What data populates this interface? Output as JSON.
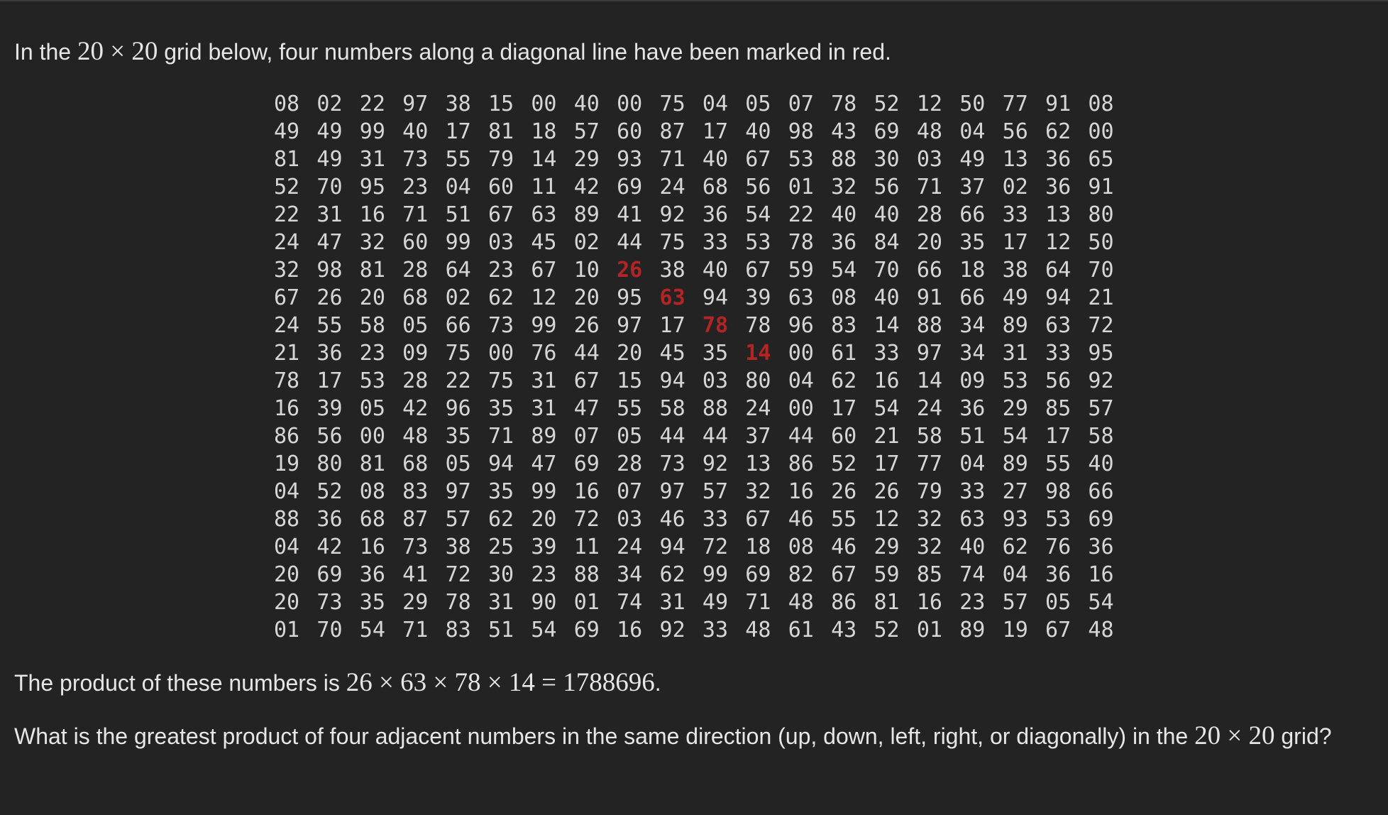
{
  "intro": {
    "before": "In the ",
    "math": "20 × 20",
    "after": " grid below, four numbers along a diagonal line have been marked in red."
  },
  "grid": {
    "rows": [
      [
        "08",
        "02",
        "22",
        "97",
        "38",
        "15",
        "00",
        "40",
        "00",
        "75",
        "04",
        "05",
        "07",
        "78",
        "52",
        "12",
        "50",
        "77",
        "91",
        "08"
      ],
      [
        "49",
        "49",
        "99",
        "40",
        "17",
        "81",
        "18",
        "57",
        "60",
        "87",
        "17",
        "40",
        "98",
        "43",
        "69",
        "48",
        "04",
        "56",
        "62",
        "00"
      ],
      [
        "81",
        "49",
        "31",
        "73",
        "55",
        "79",
        "14",
        "29",
        "93",
        "71",
        "40",
        "67",
        "53",
        "88",
        "30",
        "03",
        "49",
        "13",
        "36",
        "65"
      ],
      [
        "52",
        "70",
        "95",
        "23",
        "04",
        "60",
        "11",
        "42",
        "69",
        "24",
        "68",
        "56",
        "01",
        "32",
        "56",
        "71",
        "37",
        "02",
        "36",
        "91"
      ],
      [
        "22",
        "31",
        "16",
        "71",
        "51",
        "67",
        "63",
        "89",
        "41",
        "92",
        "36",
        "54",
        "22",
        "40",
        "40",
        "28",
        "66",
        "33",
        "13",
        "80"
      ],
      [
        "24",
        "47",
        "32",
        "60",
        "99",
        "03",
        "45",
        "02",
        "44",
        "75",
        "33",
        "53",
        "78",
        "36",
        "84",
        "20",
        "35",
        "17",
        "12",
        "50"
      ],
      [
        "32",
        "98",
        "81",
        "28",
        "64",
        "23",
        "67",
        "10",
        "26",
        "38",
        "40",
        "67",
        "59",
        "54",
        "70",
        "66",
        "18",
        "38",
        "64",
        "70"
      ],
      [
        "67",
        "26",
        "20",
        "68",
        "02",
        "62",
        "12",
        "20",
        "95",
        "63",
        "94",
        "39",
        "63",
        "08",
        "40",
        "91",
        "66",
        "49",
        "94",
        "21"
      ],
      [
        "24",
        "55",
        "58",
        "05",
        "66",
        "73",
        "99",
        "26",
        "97",
        "17",
        "78",
        "78",
        "96",
        "83",
        "14",
        "88",
        "34",
        "89",
        "63",
        "72"
      ],
      [
        "21",
        "36",
        "23",
        "09",
        "75",
        "00",
        "76",
        "44",
        "20",
        "45",
        "35",
        "14",
        "00",
        "61",
        "33",
        "97",
        "34",
        "31",
        "33",
        "95"
      ],
      [
        "78",
        "17",
        "53",
        "28",
        "22",
        "75",
        "31",
        "67",
        "15",
        "94",
        "03",
        "80",
        "04",
        "62",
        "16",
        "14",
        "09",
        "53",
        "56",
        "92"
      ],
      [
        "16",
        "39",
        "05",
        "42",
        "96",
        "35",
        "31",
        "47",
        "55",
        "58",
        "88",
        "24",
        "00",
        "17",
        "54",
        "24",
        "36",
        "29",
        "85",
        "57"
      ],
      [
        "86",
        "56",
        "00",
        "48",
        "35",
        "71",
        "89",
        "07",
        "05",
        "44",
        "44",
        "37",
        "44",
        "60",
        "21",
        "58",
        "51",
        "54",
        "17",
        "58"
      ],
      [
        "19",
        "80",
        "81",
        "68",
        "05",
        "94",
        "47",
        "69",
        "28",
        "73",
        "92",
        "13",
        "86",
        "52",
        "17",
        "77",
        "04",
        "89",
        "55",
        "40"
      ],
      [
        "04",
        "52",
        "08",
        "83",
        "97",
        "35",
        "99",
        "16",
        "07",
        "97",
        "57",
        "32",
        "16",
        "26",
        "26",
        "79",
        "33",
        "27",
        "98",
        "66"
      ],
      [
        "88",
        "36",
        "68",
        "87",
        "57",
        "62",
        "20",
        "72",
        "03",
        "46",
        "33",
        "67",
        "46",
        "55",
        "12",
        "32",
        "63",
        "93",
        "53",
        "69"
      ],
      [
        "04",
        "42",
        "16",
        "73",
        "38",
        "25",
        "39",
        "11",
        "24",
        "94",
        "72",
        "18",
        "08",
        "46",
        "29",
        "32",
        "40",
        "62",
        "76",
        "36"
      ],
      [
        "20",
        "69",
        "36",
        "41",
        "72",
        "30",
        "23",
        "88",
        "34",
        "62",
        "99",
        "69",
        "82",
        "67",
        "59",
        "85",
        "74",
        "04",
        "36",
        "16"
      ],
      [
        "20",
        "73",
        "35",
        "29",
        "78",
        "31",
        "90",
        "01",
        "74",
        "31",
        "49",
        "71",
        "48",
        "86",
        "81",
        "16",
        "23",
        "57",
        "05",
        "54"
      ],
      [
        "01",
        "70",
        "54",
        "71",
        "83",
        "51",
        "54",
        "69",
        "16",
        "92",
        "33",
        "48",
        "61",
        "43",
        "52",
        "01",
        "89",
        "19",
        "67",
        "48"
      ]
    ],
    "marked_cells": [
      [
        6,
        8
      ],
      [
        7,
        9
      ],
      [
        8,
        10
      ],
      [
        9,
        11
      ]
    ],
    "marked_color": "#b32424"
  },
  "product": {
    "before": "The product of these numbers is ",
    "math": "26 × 63 × 78 × 14 = 1788696",
    "after": "."
  },
  "question": {
    "before": "What is the greatest product of four adjacent numbers in the same direction (up, down, left, right, or diagonally) in the ",
    "math": "20 × 20",
    "after": " grid?"
  }
}
